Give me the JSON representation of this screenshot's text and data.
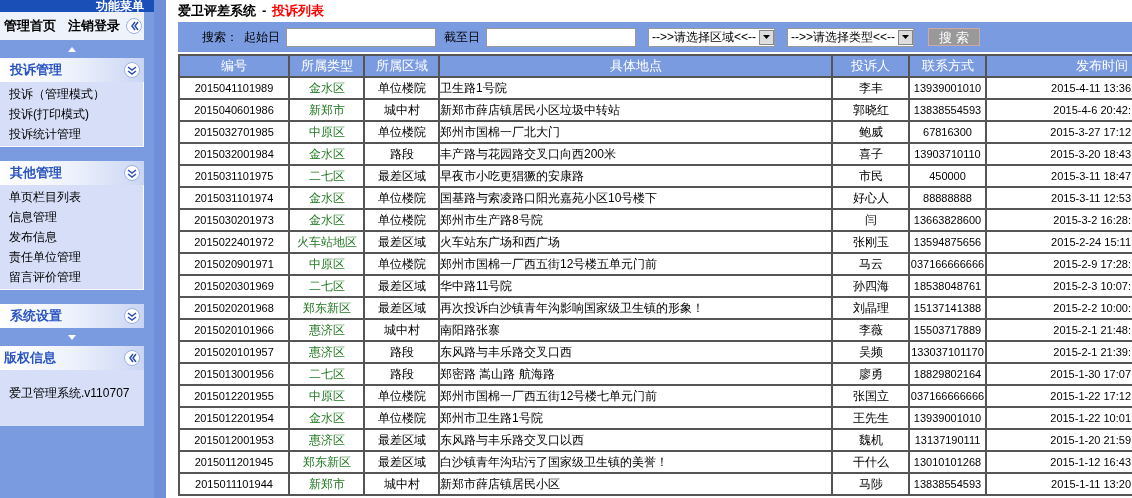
{
  "sidebar": {
    "menu_title": "功能菜单",
    "top_links": [
      "管理首页",
      "注销登录"
    ],
    "sections": [
      {
        "title": "投诉管理",
        "items": [
          "投诉（管理模式）",
          "投诉(打印模式)",
          "投诉统计管理"
        ]
      },
      {
        "title": "其他管理",
        "items": [
          "单页栏目列表",
          "信息管理",
          "发布信息",
          "责任单位管理",
          "留言评价管理"
        ]
      },
      {
        "title": "系统设置"
      }
    ],
    "copyright": {
      "title": "版权信息",
      "text": "爱卫管理系统.v110707"
    }
  },
  "page": {
    "system_name": "爱卫评差系统",
    "separator": "-",
    "page_title": "投诉列表"
  },
  "search": {
    "label": "搜索：",
    "start_label": "起始日",
    "end_label": "截至日",
    "area_select": "-->>请选择区域<<--",
    "type_select": "-->>请选择类型<<--",
    "button": "搜 索"
  },
  "table": {
    "columns": [
      "编号",
      "所属类型",
      "所属区域",
      "具体地点",
      "投诉人",
      "联系方式",
      "发布时间"
    ],
    "rows": [
      [
        "2015041101989",
        "金水区",
        "单位楼院",
        "卫生路1号院",
        "李丰",
        "13939001010",
        "2015-4-11 13:36"
      ],
      [
        "2015040601986",
        "新郑市",
        "城中村",
        "新郑市薛店镇居民小区垃圾中转站",
        "郭晓红",
        "13838554593",
        "2015-4-6 20:42:"
      ],
      [
        "2015032701985",
        "中原区",
        "单位楼院",
        "郑州市国棉一厂北大门",
        "鲍威",
        "67816300",
        "2015-3-27 17:12"
      ],
      [
        "2015032001984",
        "金水区",
        "路段",
        "丰产路与花园路交叉口向西200米",
        "喜子",
        "13903710110",
        "2015-3-20 18:43"
      ],
      [
        "2015031101975",
        "二七区",
        "最差区域",
        "早夜市小吃更猖獗的安康路",
        "市民",
        "450000",
        "2015-3-11 18:47"
      ],
      [
        "2015031101974",
        "金水区",
        "单位楼院",
        "国基路与索凌路口阳光嘉苑小区10号楼下",
        "好心人",
        "88888888",
        "2015-3-11 12:53"
      ],
      [
        "2015030201973",
        "金水区",
        "单位楼院",
        "郑州市生产路8号院",
        "闫",
        "13663828600",
        "2015-3-2 16:28:"
      ],
      [
        "2015022401972",
        "火车站地区",
        "最差区域",
        "火车站东广场和西广场",
        "张刚玉",
        "13594875656",
        "2015-2-24 15:11"
      ],
      [
        "2015020901971",
        "中原区",
        "单位楼院",
        "郑州市国棉一厂西五街12号楼五单元门前",
        "马云",
        "037166666666",
        "2015-2-9 17:28:"
      ],
      [
        "2015020301969",
        "二七区",
        "最差区域",
        "华中路11号院",
        "孙四海",
        "18538048761",
        "2015-2-3 10:07:"
      ],
      [
        "2015020201968",
        "郑东新区",
        "最差区域",
        "再次投诉白沙镇青年沟影响国家级卫生镇的形象！",
        "刘晶理",
        "15137141388",
        "2015-2-2 10:00:"
      ],
      [
        "2015020101966",
        "惠济区",
        "城中村",
        "南阳路张寨",
        "李薇",
        "15503717889",
        "2015-2-1 21:48:"
      ],
      [
        "2015020101957",
        "惠济区",
        "路段",
        "东风路与丰乐路交叉口西",
        "吴频",
        "133037101170",
        "2015-2-1 21:39:"
      ],
      [
        "2015013001956",
        "二七区",
        "路段",
        "郑密路 嵩山路 航海路",
        "廖勇",
        "18829802164",
        "2015-1-30 17:07"
      ],
      [
        "2015012201955",
        "中原区",
        "单位楼院",
        "郑州市国棉一厂西五街12号楼七单元门前",
        "张国立",
        "037166666666",
        "2015-1-22 17:12"
      ],
      [
        "2015012201954",
        "金水区",
        "单位楼院",
        "郑州市卫生路1号院",
        "王先生",
        "13939001010",
        "2015-1-22 10:01"
      ],
      [
        "2015012001953",
        "惠济区",
        "最差区域",
        "东风路与丰乐路交叉口以西",
        "魏机",
        "13137190111",
        "2015-1-20 21:59"
      ],
      [
        "2015011201945",
        "郑东新区",
        "最差区域",
        "白沙镇青年沟玷污了国家级卫生镇的美誉！",
        "干什么",
        "13010101268",
        "2015-1-12 16:43"
      ],
      [
        "2015011101944",
        "新郑市",
        "城中村",
        "新郑市薛店镇居民小区",
        "马陟",
        "13838554593",
        "2015-1-11 13:20"
      ]
    ]
  }
}
